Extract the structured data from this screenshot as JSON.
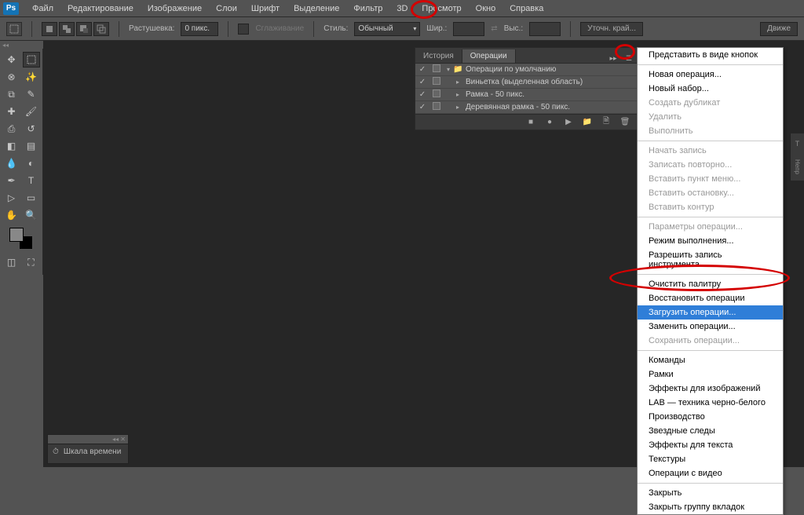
{
  "menubar": {
    "logo": "Ps",
    "items": [
      "Файл",
      "Редактирование",
      "Изображение",
      "Слои",
      "Шрифт",
      "Выделение",
      "Фильтр",
      "3D",
      "Просмотр",
      "Окно",
      "Справка"
    ]
  },
  "optbar": {
    "feather_label": "Растушевка:",
    "feather_value": "0 пикс.",
    "antialias_label": "Сглаживание",
    "style_label": "Стиль:",
    "style_value": "Обычный",
    "width_label": "Шир.:",
    "height_label": "Выс.:",
    "refine_label": "Уточн. край...",
    "right_btn": "Движе"
  },
  "actions_panel": {
    "tabs": [
      "История",
      "Операции"
    ],
    "active_tab": 1,
    "default_set": "Операции по умолчанию",
    "rows": [
      "Виньетка (выделенная область)",
      "Рамка - 50 пикс.",
      "Деревянная рамка - 50 пикс."
    ]
  },
  "flyout": {
    "groups": [
      [
        {
          "t": "Представить в виде кнопок",
          "d": false
        }
      ],
      [
        {
          "t": "Новая операция...",
          "d": false
        },
        {
          "t": "Новый набор...",
          "d": false
        },
        {
          "t": "Создать дубликат",
          "d": true
        },
        {
          "t": "Удалить",
          "d": true
        },
        {
          "t": "Выполнить",
          "d": true
        }
      ],
      [
        {
          "t": "Начать запись",
          "d": true
        },
        {
          "t": "Записать повторно...",
          "d": true
        },
        {
          "t": "Вставить пункт меню...",
          "d": true
        },
        {
          "t": "Вставить остановку...",
          "d": true
        },
        {
          "t": "Вставить контур",
          "d": true
        }
      ],
      [
        {
          "t": "Параметры операции...",
          "d": true
        },
        {
          "t": "Режим выполнения...",
          "d": false
        },
        {
          "t": "Разрешить запись инструмента",
          "d": false
        }
      ],
      [
        {
          "t": "Очистить палитру",
          "d": false
        },
        {
          "t": "Восстановить операции",
          "d": false
        },
        {
          "t": "Загрузить операции...",
          "d": false,
          "sel": true
        },
        {
          "t": "Заменить операции...",
          "d": false
        },
        {
          "t": "Сохранить операции...",
          "d": true
        }
      ],
      [
        {
          "t": "Команды",
          "d": false
        },
        {
          "t": "Рамки",
          "d": false
        },
        {
          "t": "Эффекты для изображений",
          "d": false
        },
        {
          "t": "LAB — техника черно-белого",
          "d": false
        },
        {
          "t": "Производство",
          "d": false
        },
        {
          "t": "Звездные следы",
          "d": false
        },
        {
          "t": "Эффекты для текста",
          "d": false
        },
        {
          "t": "Текстуры",
          "d": false
        },
        {
          "t": "Операции с видео",
          "d": false
        }
      ],
      [
        {
          "t": "Закрыть",
          "d": false
        },
        {
          "t": "Закрыть группу вкладок",
          "d": false
        }
      ]
    ]
  },
  "timeline": {
    "label": "Шкала времени"
  },
  "right_label": "Непр"
}
